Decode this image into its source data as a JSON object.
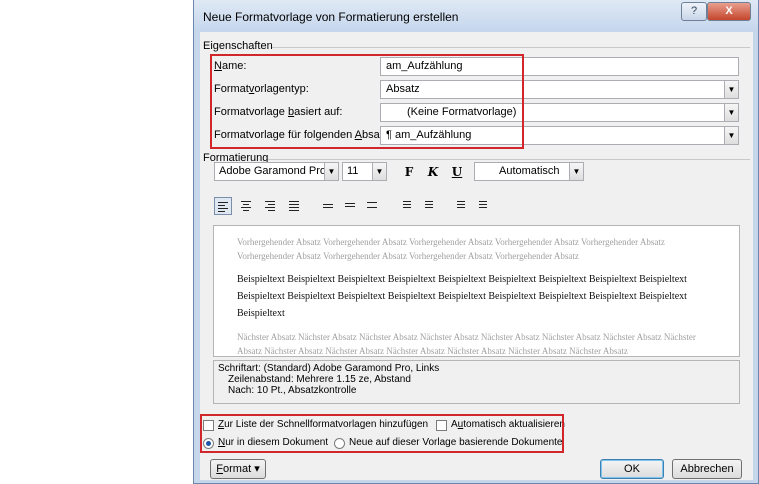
{
  "dialog": {
    "title": "Neue Formatvorlage von Formatierung erstellen",
    "help_label": "?",
    "close_label": "X"
  },
  "eigenschaften": {
    "heading": "Eigenschaften",
    "rows": [
      {
        "label_u": "N",
        "label_rest": "ame:",
        "value": "am_Aufzählung"
      },
      {
        "label_pre": "Format",
        "label_u": "v",
        "label_rest": "orlagentyp:",
        "value": "Absatz"
      },
      {
        "label_pre": "Formatvorlage ",
        "label_u": "b",
        "label_rest": "asiert auf:",
        "value": "(Keine Formatvorlage)"
      },
      {
        "label_pre": "Formatvorlage für folgenden ",
        "label_u": "A",
        "label_rest": "bsatz:",
        "value": "¶ am_Aufzählung"
      }
    ]
  },
  "formatierung": {
    "heading": "Formatierung",
    "font": "Adobe Garamond Pro",
    "size": "11",
    "bold_label": "F",
    "italic_label": "K",
    "underline_label": "U",
    "color": "Automatisch",
    "preview": {
      "previous": "Vorhergehender Absatz Vorhergehender Absatz Vorhergehender Absatz Vorhergehender Absatz Vorhergehender Absatz Vorhergehender Absatz Vorhergehender Absatz Vorhergehender Absatz Vorhergehender Absatz",
      "sample": "Beispieltext Beispieltext Beispieltext Beispieltext Beispieltext Beispieltext Beispieltext Beispieltext Beispieltext Beispieltext Beispieltext Beispieltext Beispieltext Beispieltext Beispieltext Beispieltext Beispieltext Beispieltext Beispieltext",
      "next": "Nächster Absatz Nächster Absatz Nächster Absatz Nächster Absatz Nächster Absatz Nächster Absatz Nächster Absatz Nächster Absatz Nächster Absatz Nächster Absatz Nächster Absatz Nächster Absatz Nächster Absatz Nächster Absatz"
    },
    "description": [
      "Schriftart: (Standard) Adobe Garamond Pro, Links",
      "Zeilenabstand:  Mehrere 1.15 ze, Abstand",
      "Nach:  10 Pt., Absatzkontrolle"
    ]
  },
  "options": {
    "add_quick_pre": "",
    "add_quick_u": "Z",
    "add_quick_rest": "ur Liste der Schnellformatvorlagen hinzufügen",
    "auto_update_u": "u",
    "auto_update_pre": "A",
    "auto_update_rest": "tomatisch aktualisieren",
    "only_doc_u": "N",
    "only_doc_rest": "ur in diesem Dokument",
    "new_docs": "Neue auf dieser Vorlage basierende Dokumente"
  },
  "buttons": {
    "format_u": "F",
    "format_rest": "ormat ▾",
    "ok": "OK",
    "cancel": "Abbrechen"
  },
  "colors": {
    "highlight": "#d0262c",
    "titlebar": "#c7d7eb"
  }
}
